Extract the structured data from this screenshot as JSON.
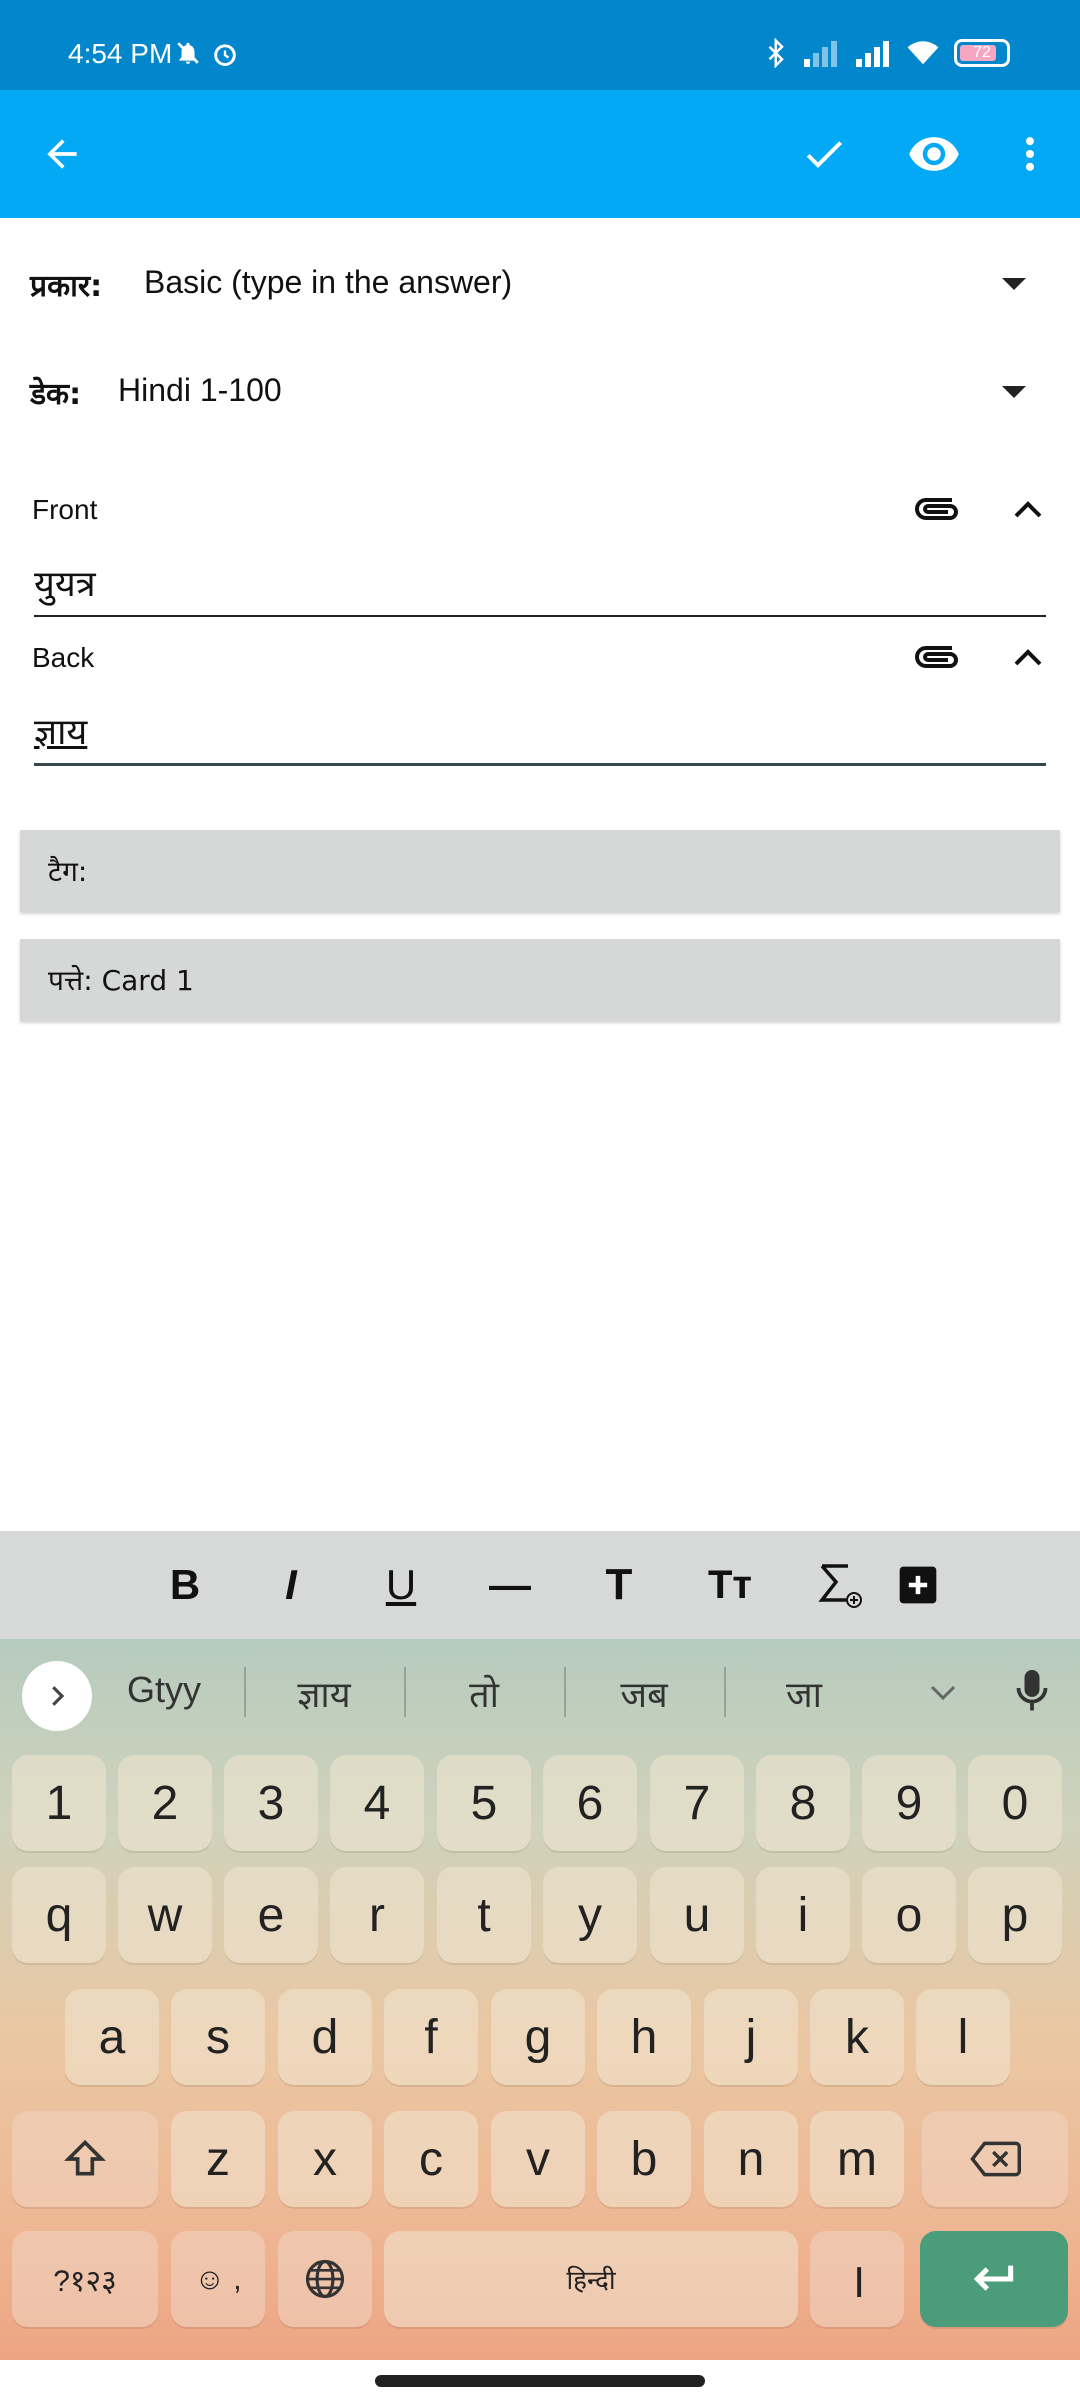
{
  "status": {
    "time": "4:54 PM",
    "battery": "72"
  },
  "form": {
    "type_label": "प्रकार:",
    "type_value": "Basic (type in the answer)",
    "deck_label": "डेक:",
    "deck_value": "Hindi 1-100",
    "fields": [
      {
        "label": "Front",
        "value": "युयत्र"
      },
      {
        "label": "Back",
        "value": "ज्ञाय"
      }
    ],
    "tags_label": "टैग:",
    "cards_label": "पत्ते: Card 1"
  },
  "format_toolbar": {
    "bold": "B",
    "italic": "I",
    "underline": "U",
    "hr": "—",
    "font": "T",
    "font_size": "Tт"
  },
  "keyboard": {
    "suggestions": [
      "Gtyy",
      "ज्ञाय",
      "तो",
      "जब",
      "जा"
    ],
    "row_numbers": [
      "1",
      "2",
      "3",
      "4",
      "5",
      "6",
      "7",
      "8",
      "9",
      "0"
    ],
    "row1": [
      "q",
      "w",
      "e",
      "r",
      "t",
      "y",
      "u",
      "i",
      "o",
      "p"
    ],
    "row2": [
      "a",
      "s",
      "d",
      "f",
      "g",
      "h",
      "j",
      "k",
      "l"
    ],
    "row3": [
      "z",
      "x",
      "c",
      "v",
      "b",
      "n",
      "m"
    ],
    "symbols_key": "?१२३",
    "emoji_key": "☺ ,",
    "space_label": "हिन्दी",
    "danda_key": "।"
  },
  "colors": {
    "status_bar": "#0286cc",
    "app_bar": "#03a9f4",
    "enter_key": "#4a9c7a"
  }
}
